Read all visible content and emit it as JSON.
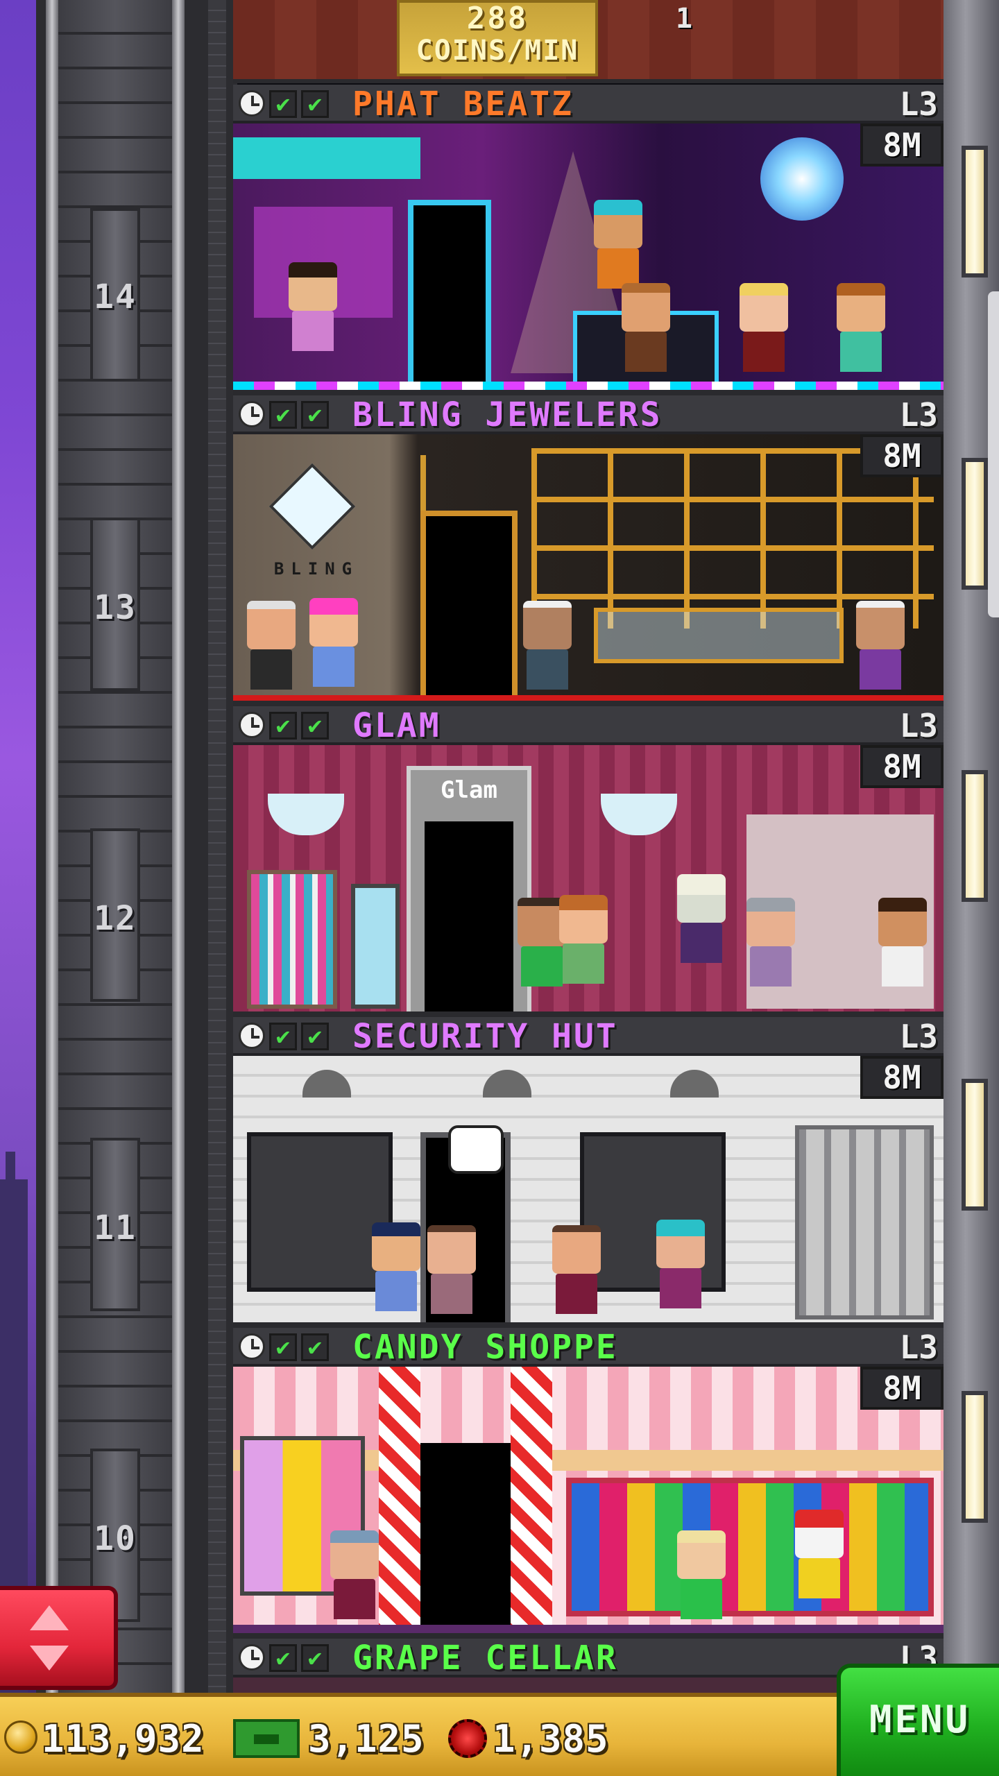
{
  "top_banner": {
    "coins_rate_value": "288",
    "coins_rate_unit": "COINS/MIN",
    "visible_digit": "1"
  },
  "floors": [
    {
      "number": "14",
      "name": "PHAT BEATZ",
      "name_color": "#ff7a2a",
      "level": "L3",
      "stock": "8M"
    },
    {
      "number": "13",
      "name": "BLING JEWELERS",
      "name_color": "#e07aff",
      "level": "L3",
      "stock": "8M"
    },
    {
      "number": "12",
      "name": "GLAM",
      "name_color": "#e07aff",
      "level": "L3",
      "stock": "8M",
      "sign": "Glam"
    },
    {
      "number": "11",
      "name": "SECURITY HUT",
      "name_color": "#e07aff",
      "level": "L3",
      "stock": "8M"
    },
    {
      "number": "10",
      "name": "CANDY SHOPPE",
      "name_color": "#5aff4a",
      "level": "L3",
      "stock": "8M"
    },
    {
      "number": "",
      "name": "GRAPE CELLAR",
      "name_color": "#5aff4a",
      "level": "L3",
      "stock": ""
    }
  ],
  "status_icons": {
    "clock": "clock-icon",
    "check": "✔"
  },
  "jewelry_sign": "BLING",
  "bottom_bar": {
    "coins": "113,932",
    "bux": "3,125",
    "points": "1,385",
    "menu_label": "MENU"
  }
}
